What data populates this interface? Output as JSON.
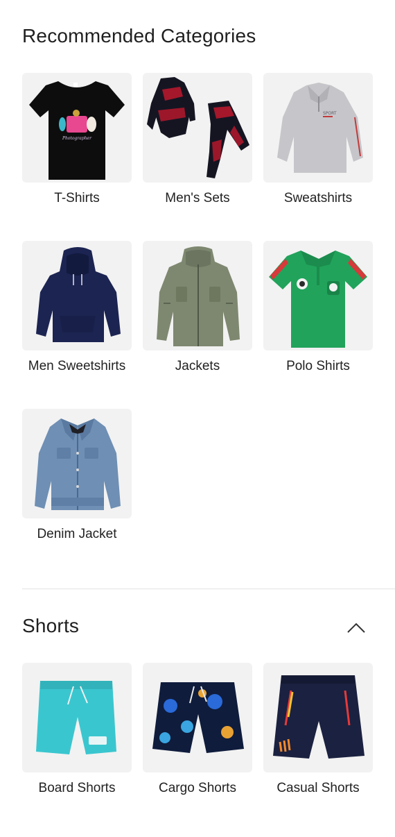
{
  "recommended": {
    "title": "Recommended Categories",
    "items": [
      {
        "label": "T-Shirts",
        "icon": "tshirt-image"
      },
      {
        "label": "Men's Sets",
        "icon": "mens-set-image"
      },
      {
        "label": "Sweatshirts",
        "icon": "sweatshirt-image"
      },
      {
        "label": "Men Sweetshirts",
        "icon": "hoodie-image"
      },
      {
        "label": "Jackets",
        "icon": "jacket-image"
      },
      {
        "label": "Polo Shirts",
        "icon": "polo-shirt-image"
      },
      {
        "label": "Denim Jacket",
        "icon": "denim-jacket-image"
      }
    ]
  },
  "shorts": {
    "title": "Shorts",
    "toggle_icon": "chevron-up-icon",
    "items": [
      {
        "label": "Board Shorts",
        "icon": "board-shorts-image"
      },
      {
        "label": "Cargo Shorts",
        "icon": "cargo-shorts-image"
      },
      {
        "label": "Casual Shorts",
        "icon": "casual-shorts-image"
      }
    ]
  },
  "colors": {
    "tile_background": "#f2f2f2",
    "divider": "#e3e3e3",
    "text": "#222222"
  }
}
